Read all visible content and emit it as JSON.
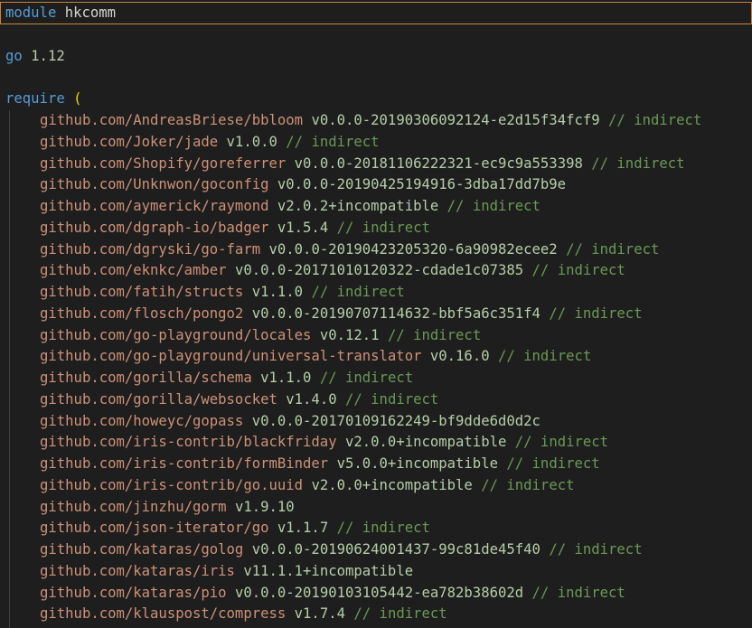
{
  "editor": {
    "module_keyword": "module",
    "module_name": "hkcomm",
    "go_keyword": "go",
    "go_version": "1.12",
    "require_keyword": "require",
    "require_open": "(",
    "comment_text": "// indirect",
    "requires": [
      {
        "path": "github.com/AndreasBriese/bbloom",
        "version": "v0.0.0-20190306092124-e2d15f34fcf9",
        "comment": "// indirect"
      },
      {
        "path": "github.com/Joker/jade",
        "version": "v1.0.0",
        "comment": "// indirect"
      },
      {
        "path": "github.com/Shopify/goreferrer",
        "version": "v0.0.0-20181106222321-ec9c9a553398",
        "comment": "// indirect"
      },
      {
        "path": "github.com/Unknwon/goconfig",
        "version": "v0.0.0-20190425194916-3dba17dd7b9e",
        "comment": ""
      },
      {
        "path": "github.com/aymerick/raymond",
        "version": "v2.0.2+incompatible",
        "comment": "// indirect"
      },
      {
        "path": "github.com/dgraph-io/badger",
        "version": "v1.5.4",
        "comment": "// indirect"
      },
      {
        "path": "github.com/dgryski/go-farm",
        "version": "v0.0.0-20190423205320-6a90982ecee2",
        "comment": "// indirect"
      },
      {
        "path": "github.com/eknkc/amber",
        "version": "v0.0.0-20171010120322-cdade1c07385",
        "comment": "// indirect"
      },
      {
        "path": "github.com/fatih/structs",
        "version": "v1.1.0",
        "comment": "// indirect"
      },
      {
        "path": "github.com/flosch/pongo2",
        "version": "v0.0.0-20190707114632-bbf5a6c351f4",
        "comment": "// indirect"
      },
      {
        "path": "github.com/go-playground/locales",
        "version": "v0.12.1",
        "comment": "// indirect"
      },
      {
        "path": "github.com/go-playground/universal-translator",
        "version": "v0.16.0",
        "comment": "// indirect"
      },
      {
        "path": "github.com/gorilla/schema",
        "version": "v1.1.0",
        "comment": "// indirect"
      },
      {
        "path": "github.com/gorilla/websocket",
        "version": "v1.4.0",
        "comment": "// indirect"
      },
      {
        "path": "github.com/howeyc/gopass",
        "version": "v0.0.0-20170109162249-bf9dde6d0d2c",
        "comment": ""
      },
      {
        "path": "github.com/iris-contrib/blackfriday",
        "version": "v2.0.0+incompatible",
        "comment": "// indirect"
      },
      {
        "path": "github.com/iris-contrib/formBinder",
        "version": "v5.0.0+incompatible",
        "comment": "// indirect"
      },
      {
        "path": "github.com/iris-contrib/go.uuid",
        "version": "v2.0.0+incompatible",
        "comment": "// indirect"
      },
      {
        "path": "github.com/jinzhu/gorm",
        "version": "v1.9.10",
        "comment": ""
      },
      {
        "path": "github.com/json-iterator/go",
        "version": "v1.1.7",
        "comment": "// indirect"
      },
      {
        "path": "github.com/kataras/golog",
        "version": "v0.0.0-20190624001437-99c81de45f40",
        "comment": "// indirect"
      },
      {
        "path": "github.com/kataras/iris",
        "version": "v11.1.1+incompatible",
        "comment": ""
      },
      {
        "path": "github.com/kataras/pio",
        "version": "v0.0.0-20190103105442-ea782b38602d",
        "comment": "// indirect"
      },
      {
        "path": "github.com/klauspost/compress",
        "version": "v1.7.4",
        "comment": "// indirect"
      }
    ]
  },
  "colors": {
    "background": "#1e1e1e",
    "keyword": "#569cd6",
    "string_path": "#ce9178",
    "number": "#b5cea8",
    "comment": "#6a9955",
    "paren": "#f1d700",
    "current_line_border": "#c6873a"
  }
}
